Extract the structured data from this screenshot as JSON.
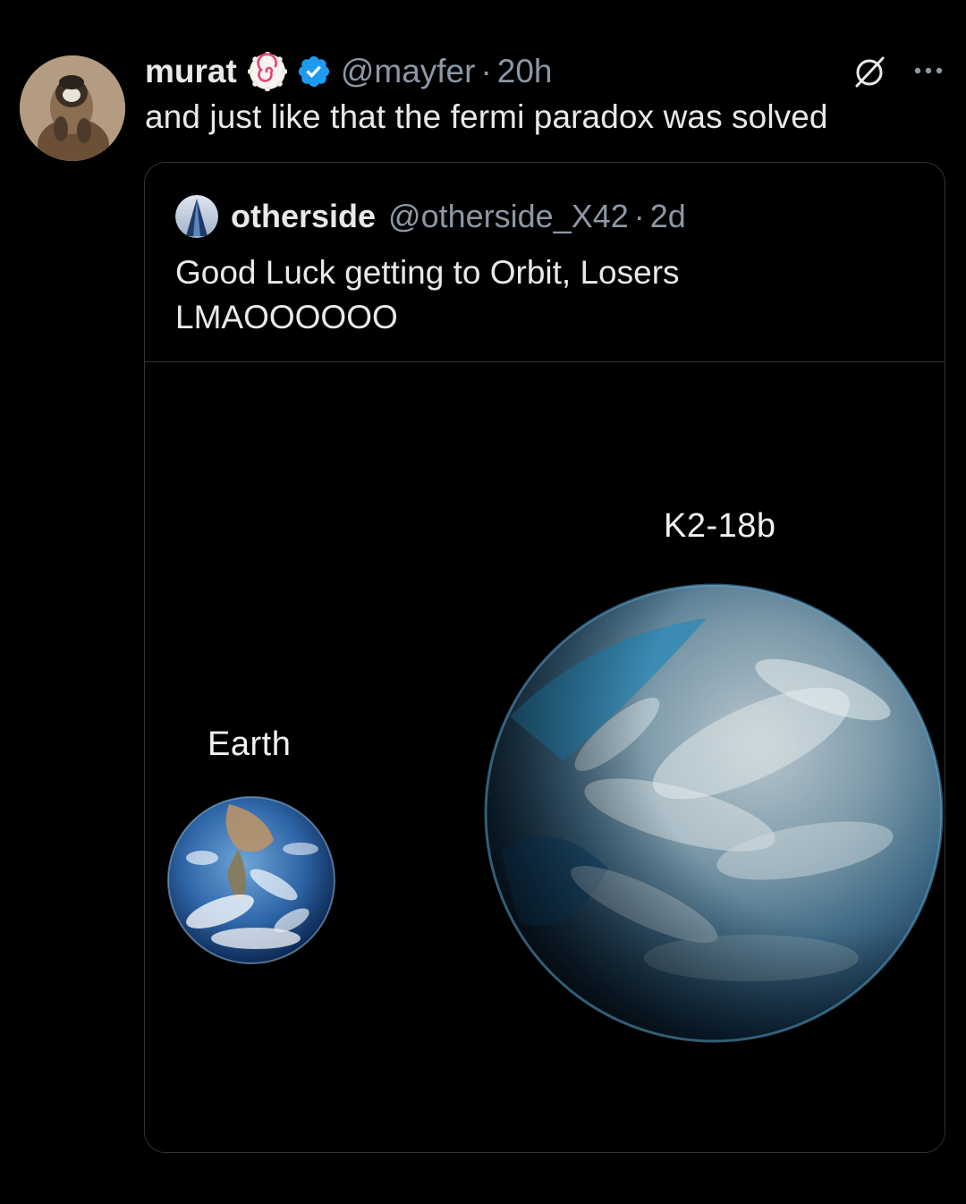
{
  "tweet": {
    "display_name": "murat",
    "handle": "@mayfer",
    "separator": "·",
    "time": "20h",
    "text": "and just like that the fermi paradox was solved",
    "badge_icon": "naruto-swirl-emoji-icon",
    "verified_icon": "verified-badge-icon",
    "verified_color": "#1d9bf0"
  },
  "quoted": {
    "display_name": "otherside",
    "handle": "@otherside_X42",
    "separator": "·",
    "time": "2d",
    "text_lines": [
      "Good Luck getting to Orbit, Losers",
      "LMAOOOOOO"
    ],
    "media": {
      "labels": {
        "earth": "Earth",
        "k2": "K2-18b"
      }
    }
  },
  "colors": {
    "background": "#000000",
    "text_primary": "#e7e9ea",
    "text_secondary": "#8b98a5",
    "border": "#2f3336"
  }
}
